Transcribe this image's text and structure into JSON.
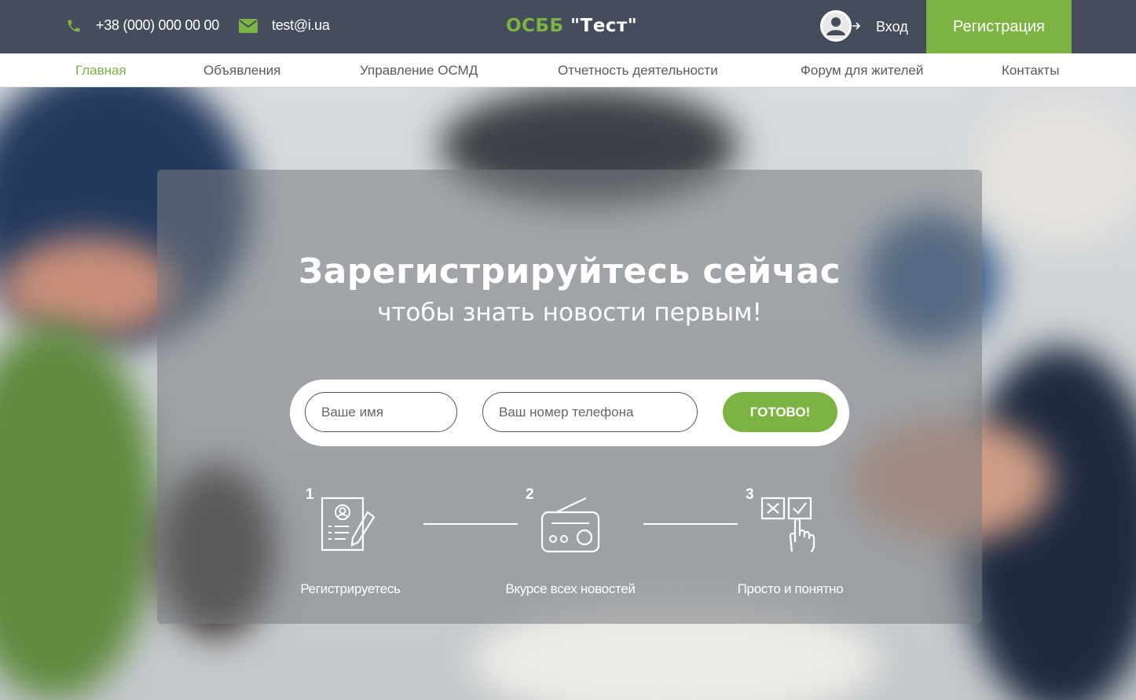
{
  "header": {
    "phone": "+38 (000) 000 00 00",
    "email": "test@i.ua",
    "logo_accent": "ОСББ",
    "logo_name": "\"Тест\"",
    "login_label": "Вход",
    "register_label": "Регистрация"
  },
  "nav": {
    "items": [
      {
        "label": "Главная",
        "active": true
      },
      {
        "label": "Объявления"
      },
      {
        "label": "Управление ОСМД"
      },
      {
        "label": "Отчетность деятельности"
      },
      {
        "label": "Форум для жителей"
      },
      {
        "label": "Контакты"
      }
    ]
  },
  "hero": {
    "title": "Зарегистрируйтесь сейчас",
    "subtitle": "чтобы знать новости первым!",
    "form": {
      "name_placeholder": "Ваше имя",
      "phone_placeholder": "Ваш номер телефона",
      "submit_label": "ГОТОВО!"
    },
    "steps": [
      {
        "number": "1",
        "label": "Регистрируетесь",
        "icon": "profile-form-icon"
      },
      {
        "number": "2",
        "label": "Вкурсе всех новостей",
        "icon": "radio-icon"
      },
      {
        "number": "3",
        "label": "Просто и понятно",
        "icon": "checkbox-hand-icon"
      }
    ]
  },
  "colors": {
    "accent": "#7cb342",
    "topbar": "#454d5d",
    "nav_text": "#555c66"
  }
}
